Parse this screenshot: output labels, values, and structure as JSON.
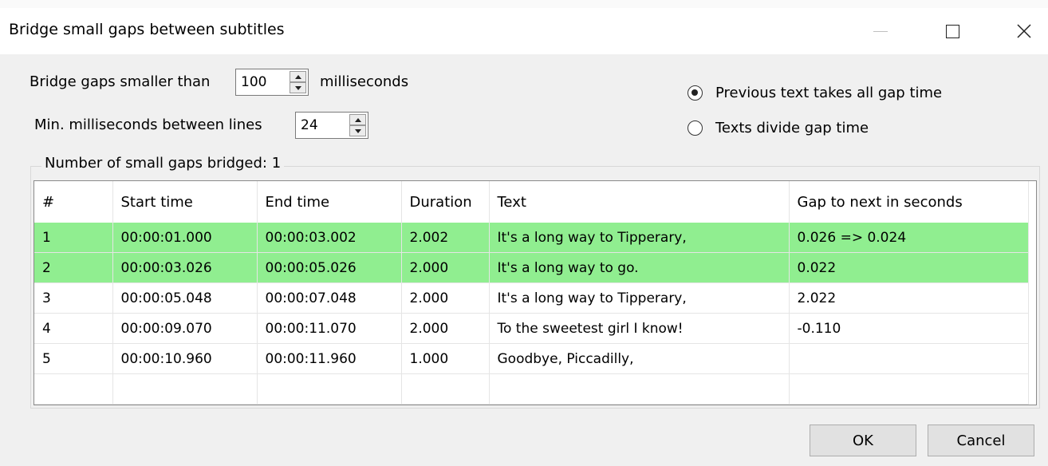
{
  "window": {
    "title": "Bridge small gaps between subtitles"
  },
  "settings": {
    "bridge_label": "Bridge gaps smaller than",
    "bridge_value": "100",
    "bridge_unit": "milliseconds",
    "min_label": "Min. milliseconds between lines",
    "min_value": "24"
  },
  "mode": {
    "previous_label": "Previous text takes all gap time",
    "previous_selected": true,
    "divide_label": "Texts divide gap time",
    "divide_selected": false
  },
  "group": {
    "label": "Number of small gaps bridged: 1"
  },
  "table": {
    "headers": [
      "#",
      "Start time",
      "End time",
      "Duration",
      "Text",
      "Gap to next in seconds"
    ],
    "highlight_color": "#90ee90",
    "rows": [
      {
        "num": "1",
        "start": "00:00:01.000",
        "end": "00:00:03.002",
        "duration": "2.002",
        "text": "It's a long way to Tipperary,",
        "gap": "0.026 => 0.024",
        "highlight": true
      },
      {
        "num": "2",
        "start": "00:00:03.026",
        "end": "00:00:05.026",
        "duration": "2.000",
        "text": "It's a long way to go.",
        "gap": "0.022",
        "highlight": true
      },
      {
        "num": "3",
        "start": "00:00:05.048",
        "end": "00:00:07.048",
        "duration": "2.000",
        "text": "It's a long way to Tipperary,",
        "gap": "2.022",
        "highlight": false
      },
      {
        "num": "4",
        "start": "00:00:09.070",
        "end": "00:00:11.070",
        "duration": "2.000",
        "text": "To the sweetest girl I know!",
        "gap": "-0.110",
        "highlight": false
      },
      {
        "num": "5",
        "start": "00:00:10.960",
        "end": "00:00:11.960",
        "duration": "1.000",
        "text": "Goodbye, Piccadilly,",
        "gap": "",
        "highlight": false
      }
    ]
  },
  "buttons": {
    "ok_label": "OK",
    "cancel_label": "Cancel"
  },
  "icons": {
    "minimize": "minimize-icon",
    "maximize": "maximize-icon",
    "close": "close-icon"
  }
}
